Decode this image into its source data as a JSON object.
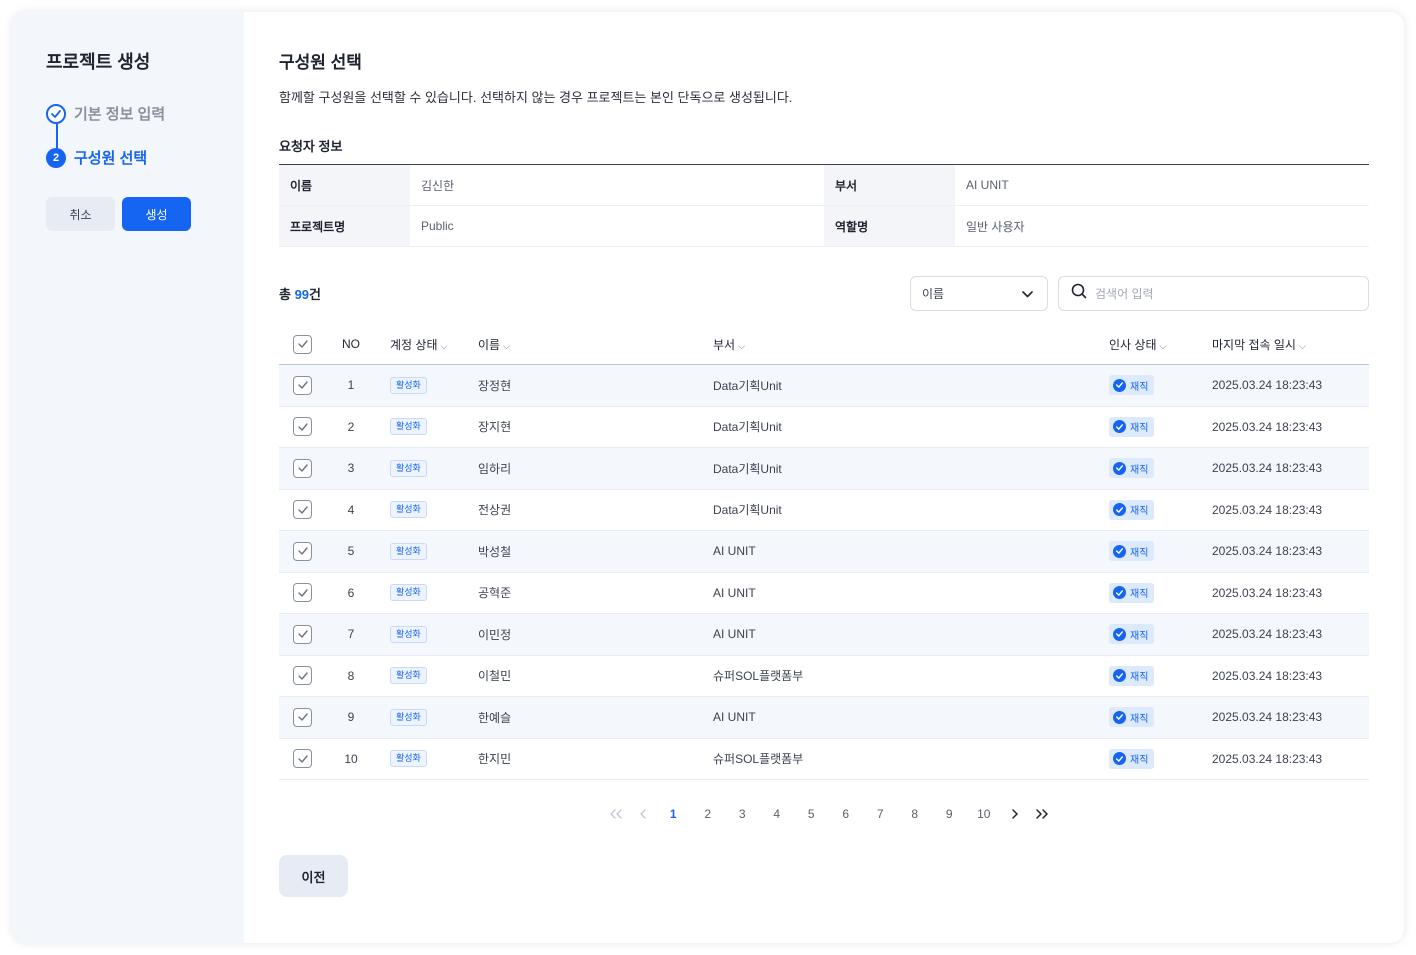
{
  "sidebar": {
    "title": "프로젝트 생성",
    "steps": [
      {
        "label": "기본 정보 입력",
        "state": "done"
      },
      {
        "number": "2",
        "label": "구성원 선택",
        "state": "active"
      }
    ],
    "cancel_label": "취소",
    "create_label": "생성"
  },
  "main": {
    "title": "구성원 선택",
    "description": "함께할 구성원을 선택할 수 있습니다. 선택하지 않는 경우 프로젝트는 본인 단독으로 생성됩니다.",
    "requester_title": "요청자 정보",
    "requester": {
      "name_label": "이름",
      "name_value": "김신한",
      "dept_label": "부서",
      "dept_value": "AI UNIT",
      "project_label": "프로젝트명",
      "project_value": "Public",
      "role_label": "역할명",
      "role_value": "일반 사용자"
    },
    "total_prefix": "총 ",
    "total_count": "99",
    "total_suffix": "건",
    "filter_select": "이름",
    "search_placeholder": "검색어 입력",
    "columns": {
      "no": "NO",
      "account_status": "계정 상태",
      "name": "이름",
      "department": "부서",
      "hr_status": "인사 상태",
      "last_access": "마지막 접속 일시"
    },
    "rows": [
      {
        "no": "1",
        "account": "활성화",
        "name": "장정현",
        "dept": "Data기획Unit",
        "hr": "재직",
        "last": "2025.03.24 18:23:43"
      },
      {
        "no": "2",
        "account": "활성화",
        "name": "장지현",
        "dept": "Data기획Unit",
        "hr": "재직",
        "last": "2025.03.24 18:23:43"
      },
      {
        "no": "3",
        "account": "활성화",
        "name": "임하리",
        "dept": "Data기획Unit",
        "hr": "재직",
        "last": "2025.03.24 18:23:43"
      },
      {
        "no": "4",
        "account": "활성화",
        "name": "전상권",
        "dept": "Data기획Unit",
        "hr": "재직",
        "last": "2025.03.24 18:23:43"
      },
      {
        "no": "5",
        "account": "활성화",
        "name": "박성철",
        "dept": "AI UNIT",
        "hr": "재직",
        "last": "2025.03.24 18:23:43"
      },
      {
        "no": "6",
        "account": "활성화",
        "name": "공혁준",
        "dept": "AI UNIT",
        "hr": "재직",
        "last": "2025.03.24 18:23:43"
      },
      {
        "no": "7",
        "account": "활성화",
        "name": "이민정",
        "dept": "AI UNIT",
        "hr": "재직",
        "last": "2025.03.24 18:23:43"
      },
      {
        "no": "8",
        "account": "활성화",
        "name": "이철민",
        "dept": "슈퍼SOL플랫폼부",
        "hr": "재직",
        "last": "2025.03.24 18:23:43"
      },
      {
        "no": "9",
        "account": "활성화",
        "name": "한예슬",
        "dept": "AI UNIT",
        "hr": "재직",
        "last": "2025.03.24 18:23:43"
      },
      {
        "no": "10",
        "account": "활성화",
        "name": "한지민",
        "dept": "슈퍼SOL플랫폼부",
        "hr": "재직",
        "last": "2025.03.24 18:23:43"
      }
    ],
    "pagination": {
      "pages": [
        "1",
        "2",
        "3",
        "4",
        "5",
        "6",
        "7",
        "8",
        "9",
        "10"
      ],
      "current": "1"
    },
    "prev_label": "이전"
  },
  "colors": {
    "accent": "#1565f2",
    "sidebar_bg": "#f3f6fb",
    "row_alt_bg": "#f4f7fb"
  },
  "icons": {
    "step_done": "check-circle-icon",
    "select": "chevron-down-icon",
    "search": "search-icon",
    "checkbox": "checkmark-icon",
    "hr_badge": "check-circle-icon",
    "first_page": "double-chevron-left-icon",
    "prev_page": "chevron-left-icon",
    "next_page": "chevron-right-icon",
    "last_page": "double-chevron-right-icon"
  }
}
